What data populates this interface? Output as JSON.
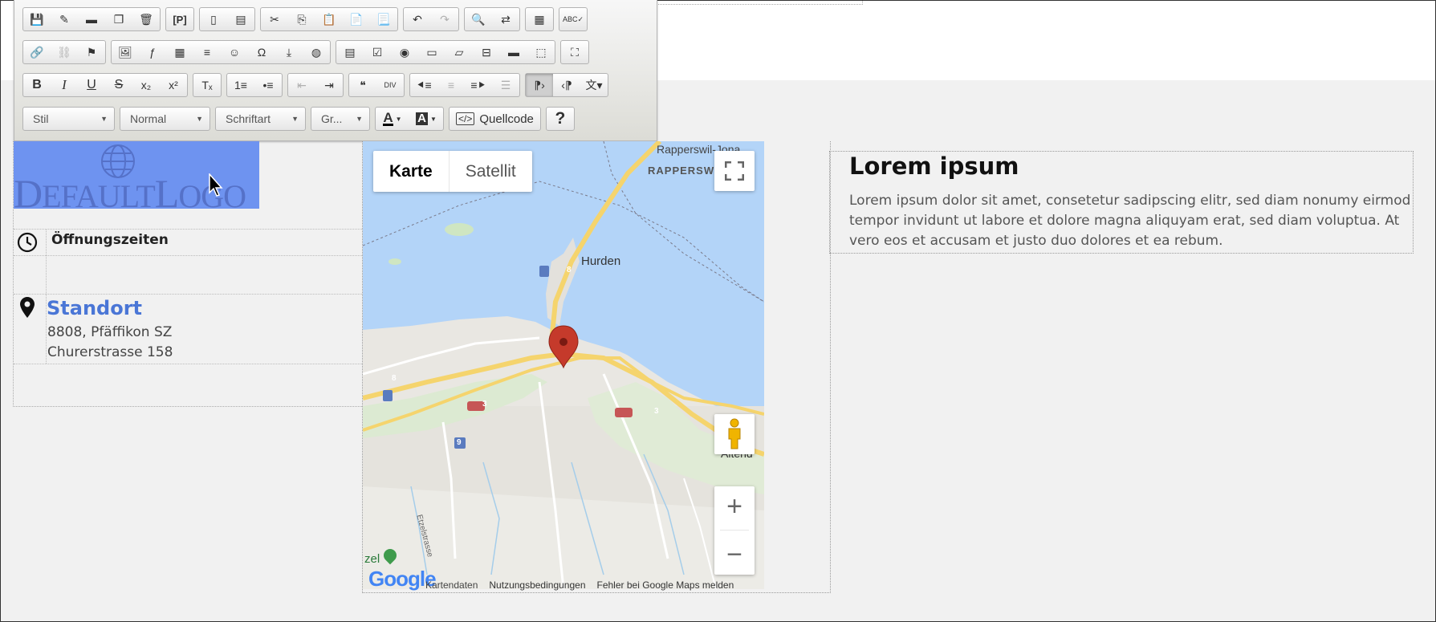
{
  "toolbar": {
    "row1_groups": [
      [
        "save-icon",
        "magic-wand-icon",
        "folder-icon",
        "copy-doc-icon",
        "trash-icon"
      ],
      [
        "placeholder-icon"
      ],
      [
        "new-page-icon",
        "preview-icon"
      ],
      [
        "cut-icon",
        "copy-icon",
        "paste-icon",
        "paste-text-icon",
        "paste-word-icon"
      ],
      [
        "undo-icon",
        "redo-icon"
      ],
      [
        "find-icon",
        "replace-icon"
      ],
      [
        "select-all-icon"
      ],
      [
        "spellcheck-icon"
      ]
    ],
    "row2_groups": [
      [
        "link-icon",
        "unlink-icon",
        "anchor-icon"
      ],
      [
        "image-icon",
        "flash-icon",
        "table-icon",
        "horizontal-line-icon",
        "smiley-icon",
        "special-char-icon",
        "page-break-icon",
        "iframe-icon"
      ],
      [
        "form-icon",
        "checkbox-icon",
        "radio-icon",
        "textfield-icon",
        "textarea-icon",
        "select-icon",
        "button-icon",
        "hidden-field-icon"
      ],
      [
        "maximize-icon"
      ]
    ],
    "row3_groups": [
      [
        "bold-icon",
        "italic-icon",
        "underline-icon",
        "strikethrough-icon",
        "subscript-icon",
        "superscript-icon"
      ],
      [
        "remove-format-icon"
      ],
      [
        "numbered-list-icon",
        "bulleted-list-icon"
      ],
      [
        "outdent-icon",
        "indent-icon"
      ],
      [
        "blockquote-icon",
        "div-icon"
      ],
      [
        "align-left-icon",
        "align-center-icon",
        "align-right-icon",
        "justify-icon"
      ],
      [
        "ltr-icon",
        "rtl-icon",
        "language-icon"
      ]
    ],
    "style_select": "Stil",
    "format_select": "Normal",
    "font_select": "Schriftart",
    "size_select": "Gr...",
    "source_label": "Quellcode",
    "help_label": "?"
  },
  "logo": {
    "text_big": "D",
    "text": "EFAULT",
    "text_big2": "L",
    "text2": "OGO"
  },
  "info": {
    "hours_title": "Öffnungszeiten",
    "location_title": "Standort",
    "address_line1": "8808, Pfäffikon SZ",
    "address_line2": "Churerstrasse 158"
  },
  "map": {
    "type_map": "Karte",
    "type_satellite": "Satellit",
    "labels": {
      "rapperswil_jona": "Rapperswil-Jona",
      "rapperswil": "RAPPERSW",
      "hurden": "Hurden",
      "altend": "Altend",
      "etzelstrasse": "Etzelstrasse",
      "zel": "zel",
      "road_8a": "8",
      "road_8b": "8",
      "road_3a": "3",
      "road_3b": "3",
      "road_9": "9"
    },
    "footer": {
      "google": "Google",
      "map_data": "Kartendaten",
      "terms": "Nutzungsbedingungen",
      "report": "Fehler bei Google Maps melden"
    },
    "zoom_in": "+",
    "zoom_out": "−"
  },
  "content": {
    "title": "Lorem ipsum",
    "body": "Lorem ipsum dolor sit amet, consetetur sadipscing elitr, sed diam nonumy eirmod tempor invidunt ut labore et dolore magna aliquyam erat, sed diam voluptua. At vero eos et accusam et justo duo dolores et ea rebum."
  },
  "colors": {
    "logo_bg": "#6e93f0",
    "accent_title": "#4a76d6",
    "water": "#b3d4f8",
    "land": "#e9e7e2",
    "road": "#f5d46d",
    "marker": "#c53a2b"
  }
}
